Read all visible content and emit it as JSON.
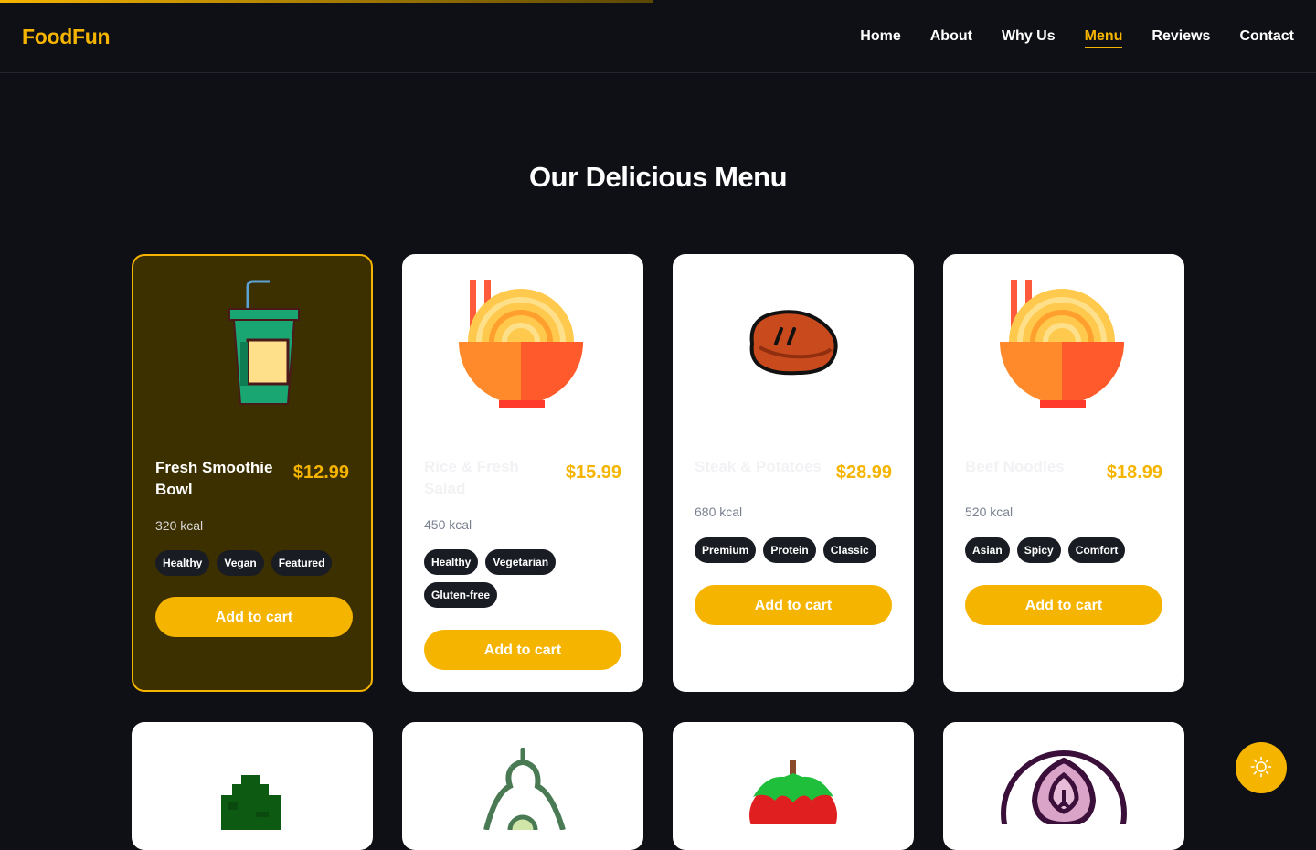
{
  "brand": "FoodFun",
  "nav": [
    "Home",
    "About",
    "Why Us",
    "Menu",
    "Reviews",
    "Contact"
  ],
  "nav_active": "Menu",
  "page_title": "Our Delicious Menu",
  "menu": [
    {
      "name": "Fresh Smoothie Bowl",
      "price": "$12.99",
      "kcal": "320 kcal",
      "tags": [
        "Healthy",
        "Vegan",
        "Featured"
      ],
      "cta": "Add to cart",
      "icon": "smoothie-cup-icon"
    },
    {
      "name": "Rice & Fresh Salad",
      "price": "$15.99",
      "kcal": "450 kcal",
      "tags": [
        "Healthy",
        "Vegetarian",
        "Gluten-free"
      ],
      "cta": "Add to cart",
      "icon": "noodle-bowl-icon"
    },
    {
      "name": "Steak & Potatoes",
      "price": "$28.99",
      "kcal": "680 kcal",
      "tags": [
        "Premium",
        "Protein",
        "Classic"
      ],
      "cta": "Add to cart",
      "icon": "steak-icon"
    },
    {
      "name": "Beef Noodles",
      "price": "$18.99",
      "kcal": "520 kcal",
      "tags": [
        "Asian",
        "Spicy",
        "Comfort"
      ],
      "cta": "Add to cart",
      "icon": "noodle-bowl-icon"
    }
  ],
  "second_row_icons": [
    "broccoli-icon",
    "avocado-icon",
    "tomato-icon",
    "onion-icon"
  ],
  "colors": {
    "accent": "#f5b400",
    "background": "#0f1015",
    "featured_card": "#3c2f00",
    "card": "#ffffff"
  },
  "theme_toggle_icon": "sun-icon"
}
